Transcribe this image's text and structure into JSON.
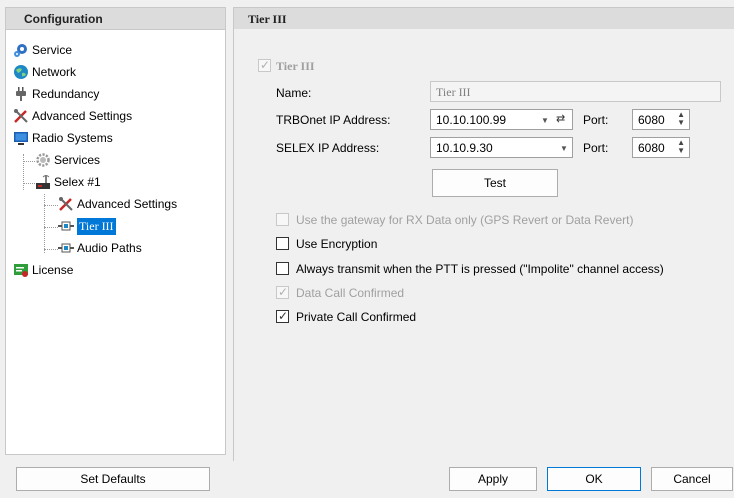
{
  "left_panel": {
    "header": "Configuration",
    "tree": [
      {
        "label": "Service",
        "icon": "service-gear-icon"
      },
      {
        "label": "Network",
        "icon": "globe-icon"
      },
      {
        "label": "Redundancy",
        "icon": "plug-icon"
      },
      {
        "label": "Advanced Settings",
        "icon": "tools-icon"
      },
      {
        "label": "Radio Systems",
        "icon": "monitor-icon"
      },
      {
        "label": "Services",
        "icon": "gear-icon"
      },
      {
        "label": "Selex #1",
        "icon": "radio-tower-icon"
      },
      {
        "label": "Advanced Settings",
        "icon": "tools-icon"
      },
      {
        "label": "Tier III",
        "icon": "connector-icon",
        "selected": true
      },
      {
        "label": "Audio Paths",
        "icon": "connector-icon"
      },
      {
        "label": "License",
        "icon": "license-icon"
      }
    ]
  },
  "right_panel": {
    "header": "Tier III",
    "tier_checkbox": {
      "label": "Tier III",
      "checked": true,
      "enabled": false
    },
    "name": {
      "label": "Name:",
      "value": "Tier III"
    },
    "trbonet_ip": {
      "label": "TRBOnet IP Address:",
      "value": "10.10.100.99",
      "port_label": "Port:",
      "port": "6080"
    },
    "selex_ip": {
      "label": "SELEX IP Address:",
      "value": "10.10.9.30",
      "port_label": "Port:",
      "port": "6080"
    },
    "test_button": "Test",
    "options": [
      {
        "label": "Use the gateway for RX Data only (GPS Revert or Data Revert)",
        "checked": false,
        "enabled": false
      },
      {
        "label": "Use Encryption",
        "checked": false,
        "enabled": true
      },
      {
        "label": "Always transmit when the PTT is pressed (\"Impolite\" channel access)",
        "checked": false,
        "enabled": true
      },
      {
        "label": "Data Call Confirmed",
        "checked": true,
        "enabled": false
      },
      {
        "label": "Private Call Confirmed",
        "checked": true,
        "enabled": true
      }
    ]
  },
  "buttons": {
    "set_defaults": "Set Defaults",
    "apply": "Apply",
    "ok": "OK",
    "cancel": "Cancel"
  },
  "colors": {
    "selection": "#0078d7",
    "header_bg": "#dcdcdc"
  }
}
